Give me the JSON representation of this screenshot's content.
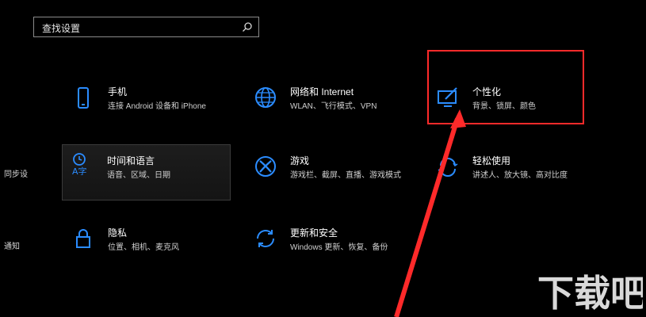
{
  "search": {
    "placeholder": "查找设置"
  },
  "tiles": [
    {
      "title": "手机",
      "desc": "连接 Android 设备和 iPhone",
      "icon": "phone-icon"
    },
    {
      "title": "网络和 Internet",
      "desc": "WLAN、飞行模式、VPN",
      "icon": "globe-icon"
    },
    {
      "title": "个性化",
      "desc": "背景、锁屏、颜色",
      "icon": "personalization-icon"
    },
    {
      "title": "时间和语言",
      "desc": "语音、区域、日期",
      "icon": "time-language-icon"
    },
    {
      "title": "游戏",
      "desc": "游戏栏、截屏、直播、游戏模式",
      "icon": "xbox-icon"
    },
    {
      "title": "轻松使用",
      "desc": "讲述人、放大镜、高对比度",
      "icon": "ease-of-access-icon"
    },
    {
      "title": "隐私",
      "desc": "位置、相机、麦克风",
      "icon": "lock-icon"
    },
    {
      "title": "更新和安全",
      "desc": "Windows 更新、恢复、备份",
      "icon": "sync-icon"
    }
  ],
  "left_labels": [
    "同步设",
    "通知"
  ],
  "watermark": "下载吧",
  "colors": {
    "accent": "#1e90ff",
    "highlight": "#ff2a2a",
    "background": "#000000"
  }
}
